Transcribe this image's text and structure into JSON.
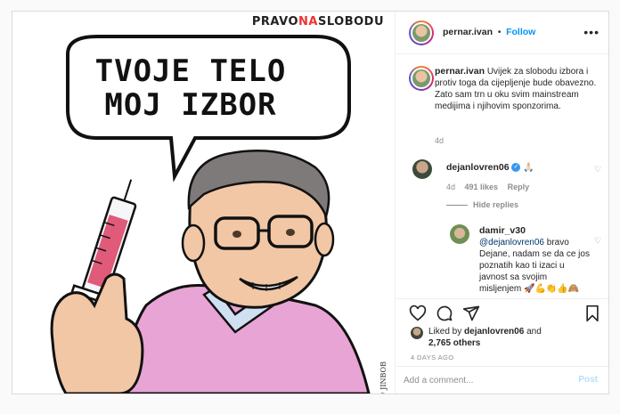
{
  "image": {
    "watermark_pre": "PRAVO",
    "watermark_na": "NA",
    "watermark_post": "SLOBODU",
    "bubble_line1": "TVOJE TELO",
    "bubble_line2": "MOJ IZBOR",
    "signature": "MADE by JINBOB"
  },
  "header": {
    "username": "pernar.ivan",
    "separator": "•",
    "follow_label": "Follow",
    "more_icon": "more-dots-icon"
  },
  "caption": {
    "username": "pernar.ivan",
    "text": "Uvijek za slobodu izbora i protiv toga da cijepljenje bude obavezno. Zato sam trn u oku svim mainstream medijima i njihovim sponzorima.",
    "age": "4d"
  },
  "comments": [
    {
      "username": "dejanlovren06",
      "text": "🙏🏻",
      "age": "4d",
      "likes": "491 likes",
      "reply_label": "Reply",
      "hide_replies_label": "Hide replies"
    }
  ],
  "reply": {
    "username": "damir_v30",
    "mention": "@dejanlovren06",
    "text": " bravo Dejane, nadam se da ce jos poznatih kao ti izaci u javnost sa svojim misljenjem 🚀💪👏👍🙈"
  },
  "likes": {
    "prefix": "Liked by ",
    "user": "dejanlovren06",
    "middle": " and",
    "count": "2,765 others"
  },
  "timestamp": "4 DAYS AGO",
  "add_comment": {
    "placeholder": "Add a comment...",
    "post_label": "Post"
  },
  "colors": {
    "follow_blue": "#0095f6",
    "post_disabled": "#b2dffc",
    "verified": "#3897f0"
  }
}
